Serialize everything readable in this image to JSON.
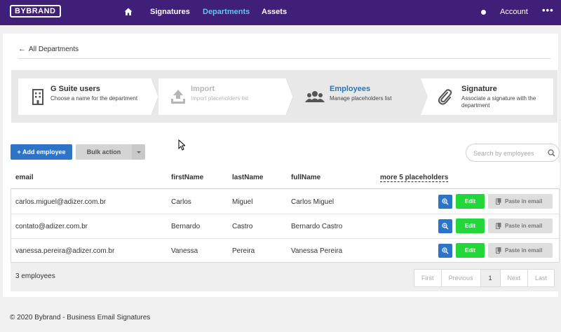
{
  "topbar": {
    "logo": "BYBRAND",
    "nav": [
      "Signatures",
      "Departments",
      "Assets"
    ],
    "active_nav": "Departments",
    "account_label": "Account",
    "more_label": "•••"
  },
  "colors": {
    "topbar": "#3f1f78",
    "active_nav": "#5ec8f0",
    "primary": "#2d74c7",
    "edit": "#23d63a"
  },
  "back_link": "All Departments",
  "steps": [
    {
      "title": "G Suite users",
      "subtitle": "Choose a name for the department",
      "icon": "building-icon",
      "state": "done"
    },
    {
      "title": "Import",
      "subtitle": "Import placeholders list",
      "icon": "upload-icon",
      "state": "disabled"
    },
    {
      "title": "Employees",
      "subtitle": "Manage placeholders list",
      "icon": "users-icon",
      "state": "active"
    },
    {
      "title": "Signature",
      "subtitle": "Associate a signature with the department",
      "icon": "paperclip-icon",
      "state": "done"
    }
  ],
  "toolbar": {
    "add_label": "+ Add employee",
    "bulk_label": "Bulk action"
  },
  "search": {
    "placeholder": "Search by employees",
    "value": ""
  },
  "table": {
    "columns": [
      "email",
      "firstName",
      "lastName",
      "fullName",
      "more 5 placeholders"
    ],
    "rows": [
      [
        "carlos.miguel@adizer.com.br",
        "Carlos",
        "Miguel",
        "Carlos Miguel"
      ],
      [
        "contato@adizer.com.br",
        "Bernardo",
        "Castro",
        "Bernardo Castro"
      ],
      [
        "vanessa.pereira@adizer.com.br",
        "Vanessa",
        "Pereira",
        "Vanessa Pereira"
      ]
    ],
    "row_actions": {
      "edit_label": "Edit",
      "paste_label": "Paste in email"
    }
  },
  "count_label": "3 employees",
  "pagination": [
    "First",
    "Previous",
    "1",
    "Next",
    "Last"
  ],
  "current_page": "1",
  "footer": "© 2020 Bybrand - Business Email Signatures"
}
